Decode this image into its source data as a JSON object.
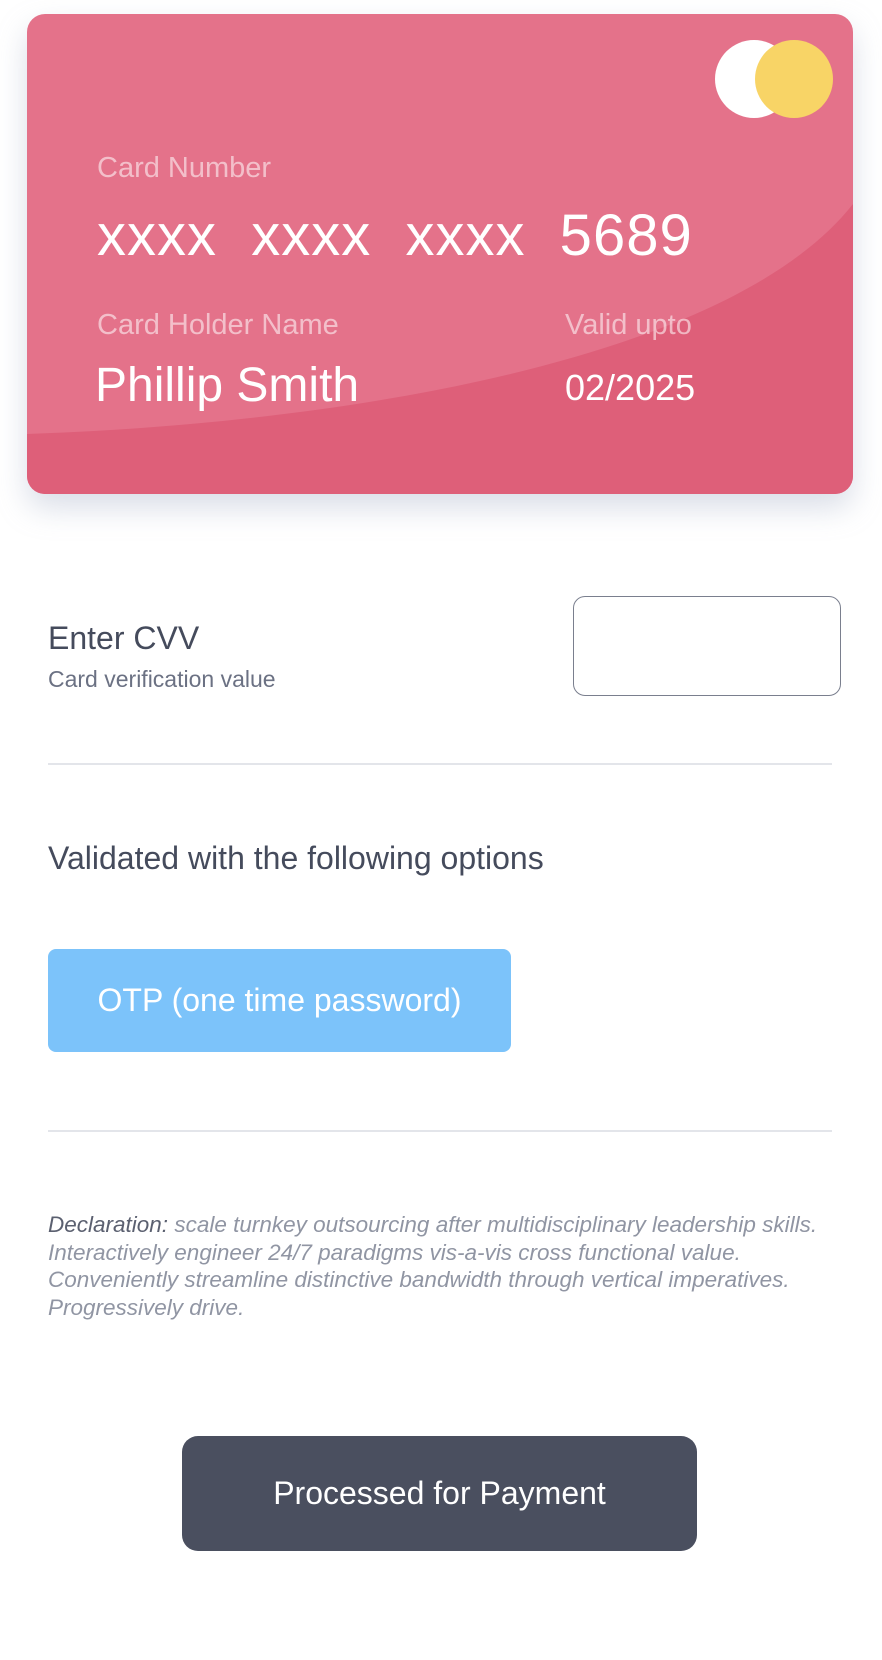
{
  "card": {
    "number_label": "Card Number",
    "number_value": "xxxx  xxxx  xxxx  5689",
    "holder_label": "Card Holder Name",
    "holder_value": "Phillip Smith",
    "valid_label": "Valid upto",
    "valid_value": "02/2025",
    "logo_icon": "card-network-logo-icon",
    "colors": {
      "card": "#e4728a",
      "card_curve": "#de5f79",
      "logo_white": "#ffffff",
      "logo_yellow": "#f8d466"
    }
  },
  "cvv": {
    "title": "Enter CVV",
    "subtitle": "Card verification value",
    "value": "",
    "placeholder": ""
  },
  "options": {
    "title": "Validated with the following options",
    "otp_label": "OTP (one time password)",
    "otp_color": "#7cc3fa"
  },
  "declaration": {
    "label": "Declaration:",
    "text": " scale turnkey outsourcing after multidisciplinary leadership skills. Interactively engineer 24/7 paradigms vis-a-vis cross functional value. Conveniently streamline distinctive bandwidth through vertical imperatives. Progressively drive."
  },
  "payment": {
    "button_label": "Processed for Payment",
    "button_color": "#4a4f5f"
  }
}
